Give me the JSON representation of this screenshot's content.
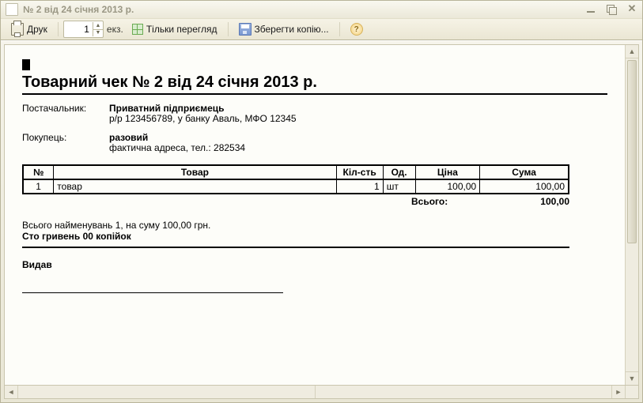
{
  "window": {
    "title": "№ 2 від 24 січня 2013 р."
  },
  "toolbar": {
    "print_label": "Друк",
    "copies_value": "1",
    "copies_unit": "екз.",
    "preview_label": "Тільки перегляд",
    "save_copy_label": "Зберегти копію..."
  },
  "doc": {
    "title": "Товарний чек № 2 від 24 січня 2013 р.",
    "supplier_label": "Постачальник:",
    "supplier_name": "Приватний підприємець",
    "supplier_details": "р/р 123456789,  у банку Аваль,  МФО 12345",
    "buyer_label": "Покупець:",
    "buyer_name": "разовий",
    "buyer_details": "фактична адреса,  тел.: 282534",
    "columns": {
      "n": "№",
      "name": "Товар",
      "qty": "Кіл-сть",
      "unit": "Од.",
      "price": "Ціна",
      "sum": "Сума"
    },
    "items": [
      {
        "n": "1",
        "name": "товар",
        "qty": "1",
        "unit": "шт",
        "price": "100,00",
        "sum": "100,00"
      }
    ],
    "total_label": "Всього:",
    "total_value": "100,00",
    "summary_line": "Всього найменувань 1, на суму 100,00 грн.",
    "amount_words": "Сто гривень 00 копійок",
    "issued_label": "Видав"
  }
}
